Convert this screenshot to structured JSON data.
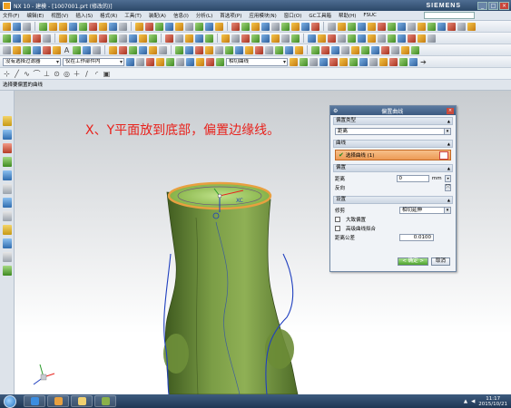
{
  "window": {
    "title": "NX 10 - 建模 - [1007001.prt (修改的)]",
    "brand": "SIEMENS"
  },
  "menu": [
    "文件(F)",
    "编辑(E)",
    "视图(V)",
    "插入(S)",
    "格式(R)",
    "工具(T)",
    "装配(A)",
    "信息(I)",
    "分析(L)",
    "首选项(P)",
    "应用模块(N)",
    "窗口(O)",
    "GC工具箱",
    "帮助(H)",
    "FSUC"
  ],
  "selection_bar": {
    "filter": "没有选择过滤器",
    "scope": "仅在工作部件内",
    "curve_rule": "相切曲线"
  },
  "cue_line": "选择要偏置的曲线",
  "caption": "X、Y平面放到底部，偏置边缘线。",
  "model": {
    "xc_label": "XC"
  },
  "dialog": {
    "title": "偏置曲线",
    "type_group": "偏置类型",
    "type_value": "距离",
    "curve_group": "曲线",
    "curve_select": "选择曲线 (1)",
    "offset_group": "偏置",
    "distance_label": "距离",
    "distance_value": "0",
    "distance_unit": "mm",
    "reverse_label": "反向",
    "settings_group": "设置",
    "trim_label": "修剪",
    "trim_value": "相切延伸",
    "opt1_label": "大致偏置",
    "opt2_label": "高级曲线拟合",
    "tolerance_label": "距离公差",
    "tolerance_value": "0.0100",
    "ok_label": "确定",
    "cancel_label": "取消"
  },
  "taskbar": {
    "time": "11:17",
    "date": "2015/10/21"
  },
  "colors": {
    "caption": "#e8221c",
    "model_green": "#6a8a3a",
    "selected_curve": "#e8a040",
    "ok_button": "#4ea22c"
  }
}
